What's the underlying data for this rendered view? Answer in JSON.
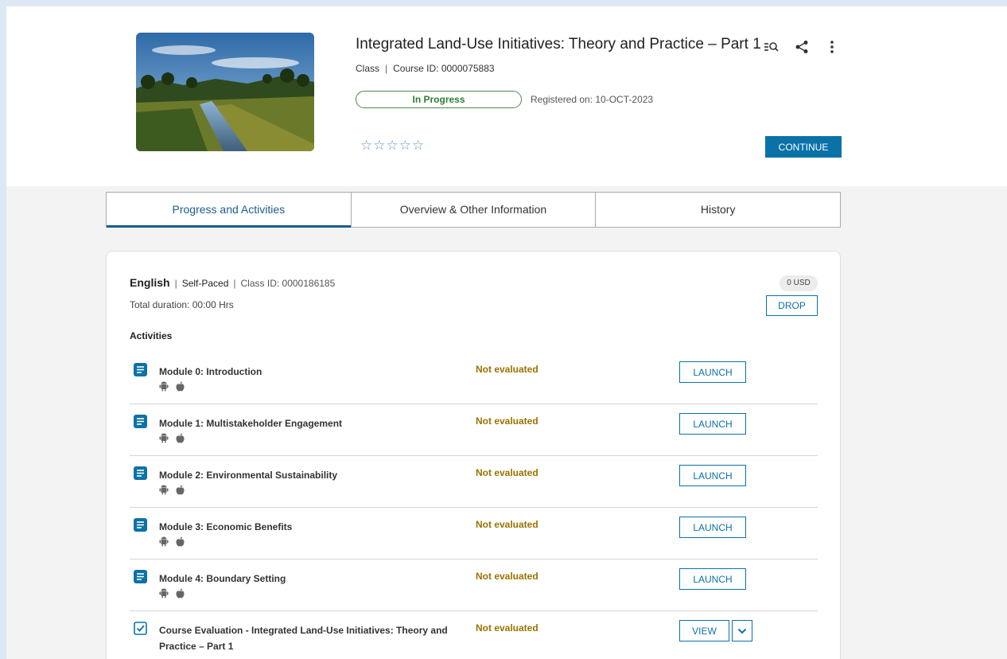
{
  "course": {
    "title": "Integrated Land-Use Initiatives: Theory and Practice – Part 1",
    "type": "Class",
    "course_id": "Course ID: 0000075883",
    "status": "In Progress",
    "registered": "Registered on: 10-OCT-2023",
    "rating_stars": 0,
    "continue_label": "CONTINUE",
    "thumbnail_icon": "landscape-photo"
  },
  "header_icons": [
    "search-list-icon",
    "share-icon",
    "more-vert-icon"
  ],
  "tabs": [
    {
      "label": "Progress and Activities",
      "active": true
    },
    {
      "label": "Overview & Other Information",
      "active": false
    },
    {
      "label": "History",
      "active": false
    }
  ],
  "class_info": {
    "language": "English",
    "pace": "Self-Paced",
    "class_id": "Class ID: 0000186185",
    "duration": "Total duration: 00:00 Hrs",
    "price": "0 USD",
    "drop_label": "DROP"
  },
  "activities_heading": "Activities",
  "activities": [
    {
      "name": "Module 0: Introduction",
      "status": "Not evaluated",
      "action": "LAUNCH",
      "icon": "document-icon"
    },
    {
      "name": "Module 1: Multistakeholder Engagement",
      "status": "Not evaluated",
      "action": "LAUNCH",
      "icon": "document-icon"
    },
    {
      "name": "Module 2: Environmental Sustainability",
      "status": "Not evaluated",
      "action": "LAUNCH",
      "icon": "document-icon"
    },
    {
      "name": "Module 3: Economic Benefits",
      "status": "Not evaluated",
      "action": "LAUNCH",
      "icon": "document-icon"
    },
    {
      "name": "Module 4: Boundary Setting",
      "status": "Not evaluated",
      "action": "LAUNCH",
      "icon": "document-icon"
    },
    {
      "name": "Course Evaluation - Integrated Land-Use Initiatives: Theory and Practice – Part 1",
      "status": "Not evaluated",
      "action": "VIEW",
      "icon": "checkbox-icon"
    }
  ],
  "colors": {
    "accent": "#0b72a8",
    "status_green": "#2e7d32",
    "status_gold": "#9a7300",
    "star": "#6a98c4",
    "page_bg": "#dde8f4"
  }
}
